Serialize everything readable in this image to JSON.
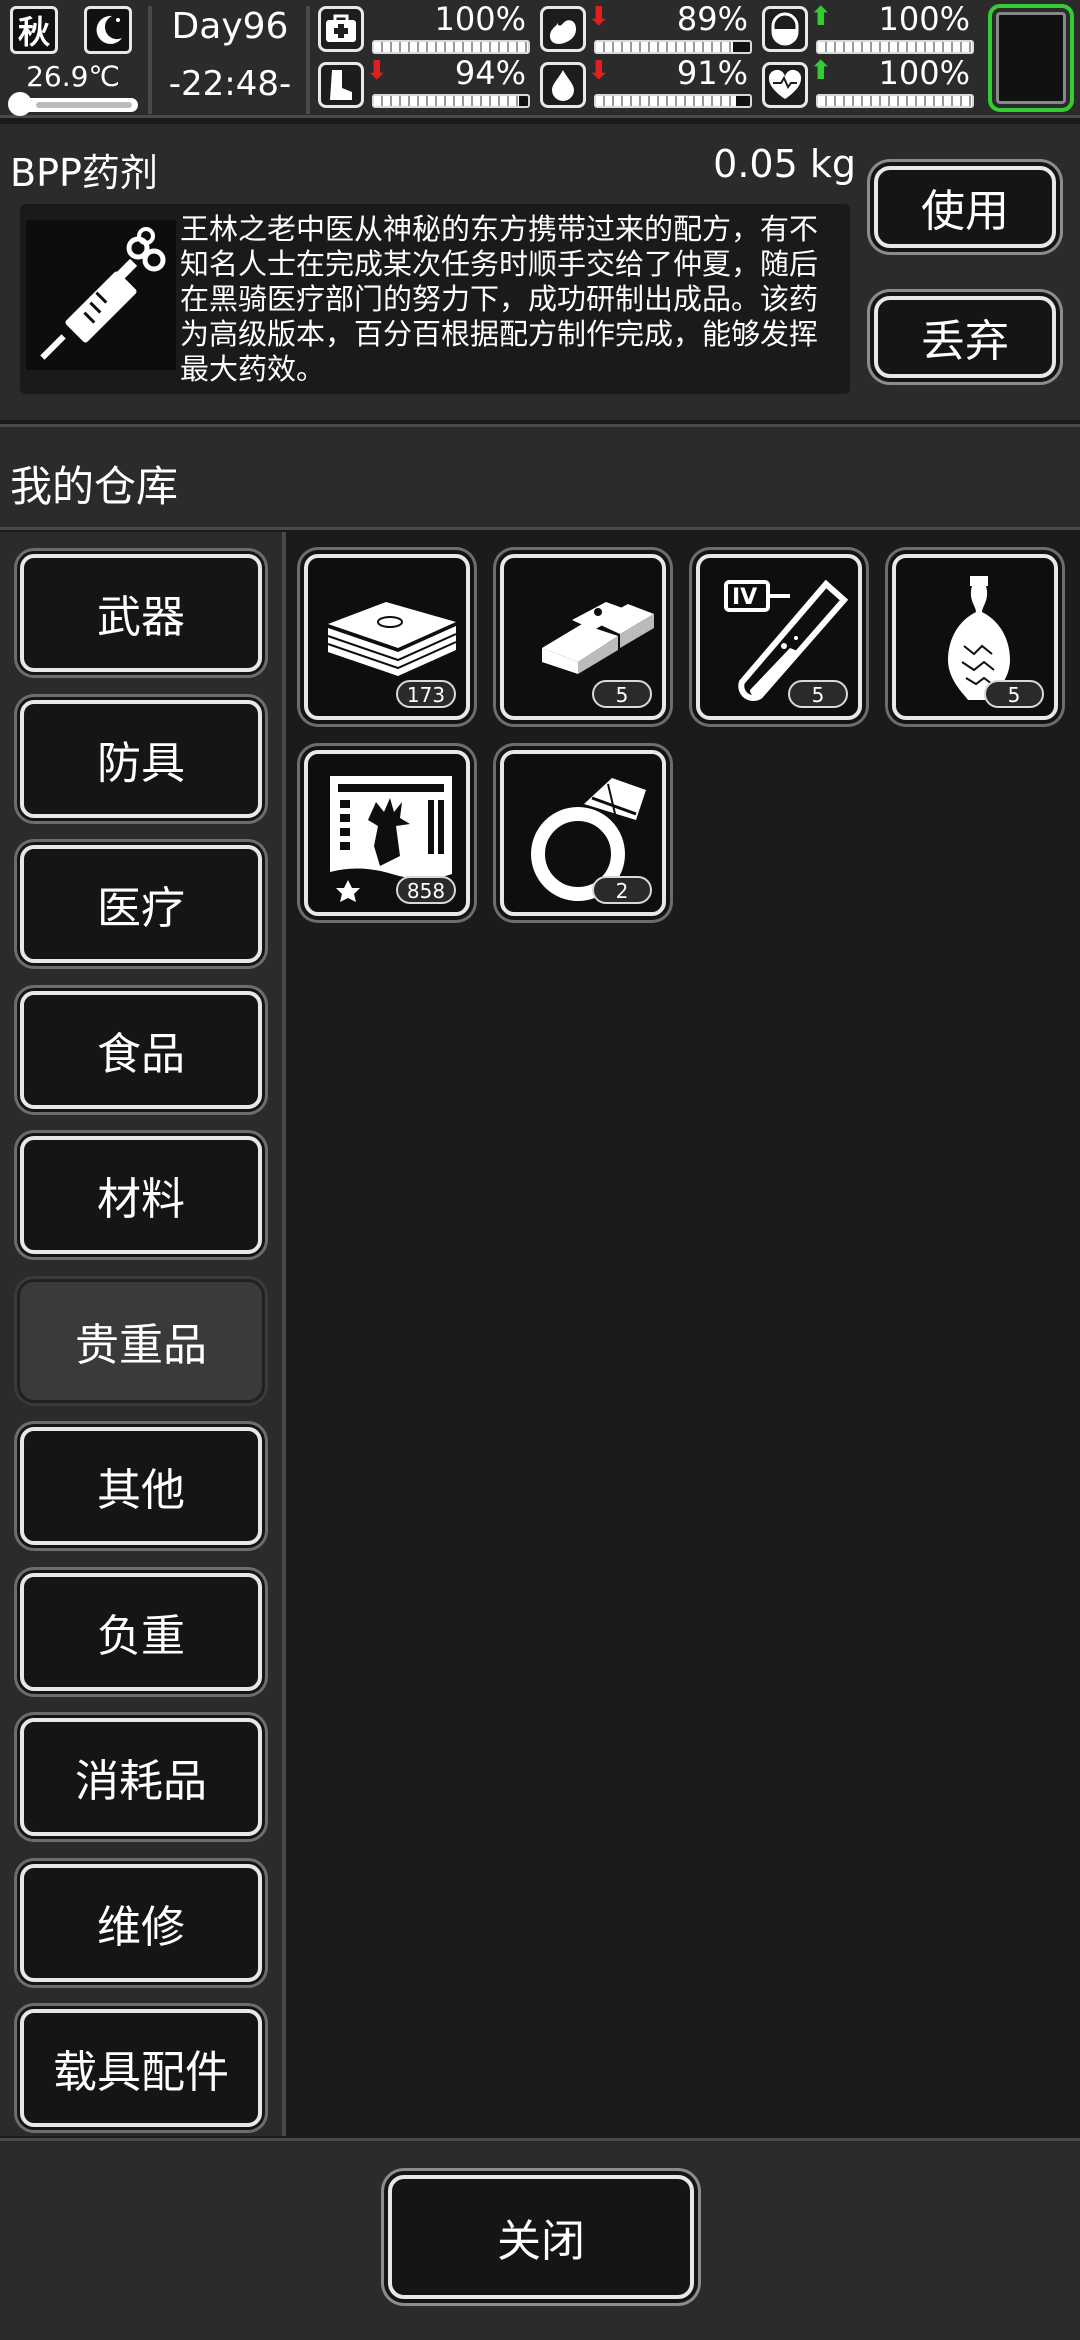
{
  "status": {
    "season": "秋",
    "temperature": "26.9℃",
    "day": "Day96",
    "time": "-22:48-",
    "stats": [
      {
        "icon": "medkit-icon",
        "value": "100%",
        "level": 1.0,
        "arrow": ""
      },
      {
        "icon": "stomach-icon",
        "value": "89%",
        "level": 0.89,
        "arrow": "down"
      },
      {
        "icon": "capsule-icon",
        "value": "100%",
        "level": 1.0,
        "arrow": "up"
      },
      {
        "icon": "foot-icon",
        "value": "94%",
        "level": 0.94,
        "arrow": "down"
      },
      {
        "icon": "water-drop-icon",
        "value": "91%",
        "level": 0.91,
        "arrow": "down"
      },
      {
        "icon": "heart-icon",
        "value": "100%",
        "level": 1.0,
        "arrow": "up"
      }
    ],
    "accent": "#33cc33"
  },
  "item": {
    "name": "BPP药剂",
    "weight": "0.05 kg",
    "description": "王林之老中医从神秘的东方携带过来的配方，有不知名人士在完成某次任务时顺手交给了仲夏，随后在黑骑医疗部门的努力下，成功研制出成品。该药为高级版本，百分百根据配方制作完成，能够发挥最大药效。",
    "icon": "syringe-icon",
    "use_label": "使用",
    "discard_label": "丢弃"
  },
  "warehouse": {
    "title": "我的仓库",
    "categories": [
      {
        "label": "武器"
      },
      {
        "label": "防具"
      },
      {
        "label": "医疗"
      },
      {
        "label": "食品"
      },
      {
        "label": "材料"
      },
      {
        "label": "贵重品",
        "selected": true
      },
      {
        "label": "其他"
      },
      {
        "label": "负重"
      },
      {
        "label": "消耗品"
      },
      {
        "label": "维修"
      },
      {
        "label": "载具配件"
      }
    ],
    "items": [
      {
        "icon": "cash-stack-icon",
        "count": "173"
      },
      {
        "icon": "gold-bars-icon",
        "count": "5"
      },
      {
        "icon": "test-tube-iv-icon",
        "count": "5"
      },
      {
        "icon": "porcelain-vase-icon",
        "count": "5"
      },
      {
        "icon": "film-poster-icon",
        "count": "858"
      },
      {
        "icon": "diamond-ring-icon",
        "count": "2"
      }
    ]
  },
  "close_label": "关闭"
}
